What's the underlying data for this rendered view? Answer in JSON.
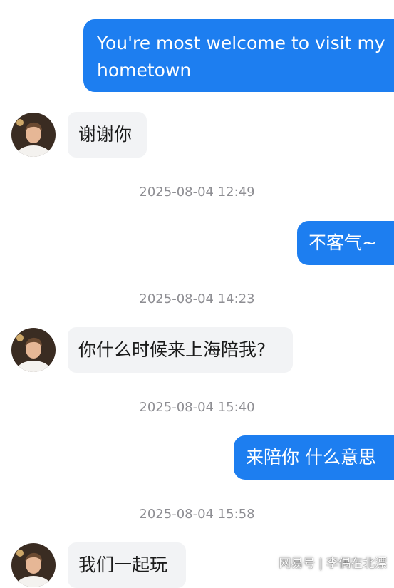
{
  "conversation": {
    "messages": [
      {
        "direction": "outgoing",
        "text_line1": "You're most welcome to visit my",
        "text_line2": "hometown"
      },
      {
        "direction": "incoming",
        "text": "谢谢你"
      },
      {
        "timestamp": "2025-08-04 12:49"
      },
      {
        "direction": "outgoing",
        "text": "不客气~"
      },
      {
        "timestamp": "2025-08-04 14:23"
      },
      {
        "direction": "incoming",
        "text": "你什么时候来上海陪我?"
      },
      {
        "timestamp": "2025-08-04 15:40"
      },
      {
        "direction": "outgoing",
        "text": "来陪你 什么意思"
      },
      {
        "timestamp": "2025-08-04 15:58"
      },
      {
        "direction": "incoming",
        "text": "我们一起玩"
      }
    ]
  },
  "watermark": {
    "site": "网易号",
    "separator": "|",
    "author": "李偶在北漂"
  },
  "colors": {
    "outgoing_bubble": "#1d7ef0",
    "incoming_bubble": "#f2f3f5",
    "timestamp_text": "#8e8e93"
  },
  "icons": {
    "contact_avatar": "person-avatar-icon"
  }
}
